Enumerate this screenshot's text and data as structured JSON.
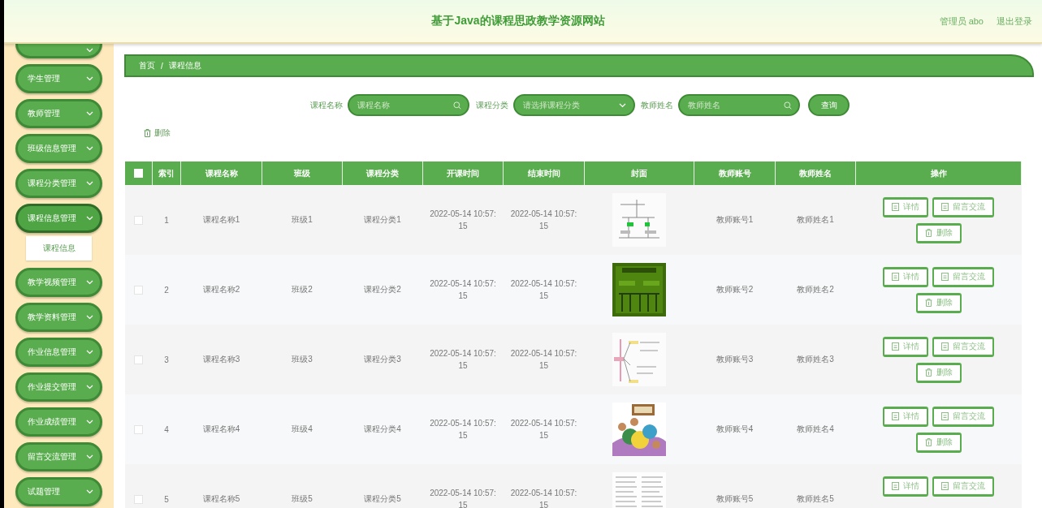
{
  "header": {
    "title": "基于Java的课程思政教学资源网站",
    "user": "管理员 abo",
    "logout": "退出登录"
  },
  "sidebar": {
    "items": [
      {
        "expanded": false
      },
      {
        "label": "学生管理",
        "expanded": false
      },
      {
        "label": "教师管理",
        "expanded": false
      },
      {
        "label": "班级信息管理",
        "expanded": false
      },
      {
        "label": "课程分类管理",
        "expanded": false
      },
      {
        "label": "课程信息管理",
        "expanded": true,
        "children": [
          {
            "label": "课程信息",
            "selected": true
          }
        ]
      },
      {
        "label": "教学视频管理",
        "expanded": false
      },
      {
        "label": "教学资料管理",
        "expanded": false
      },
      {
        "label": "作业信息管理",
        "expanded": false
      },
      {
        "label": "作业提交管理",
        "expanded": false
      },
      {
        "label": "作业成绩管理",
        "expanded": false
      },
      {
        "label": "留言交流管理",
        "expanded": false
      },
      {
        "label": "试题管理",
        "expanded": false
      }
    ]
  },
  "breadcrumb": {
    "items": [
      "首页",
      "课程信息"
    ],
    "separator": "/"
  },
  "search": {
    "fields": [
      {
        "label": "课程名称",
        "placeholder": "课程名称",
        "kind": "text"
      },
      {
        "label": "课程分类",
        "placeholder": "请选择课程分类",
        "kind": "select"
      },
      {
        "label": "教师姓名",
        "placeholder": "教师姓名",
        "kind": "text"
      }
    ],
    "button": "查询"
  },
  "toolbar": {
    "delete": "删除"
  },
  "table": {
    "select_all": {
      "checked": false
    },
    "columns": [
      "索引",
      "课程名称",
      "班级",
      "课程分类",
      "开课时间",
      "结束时间",
      "封面",
      "教师账号",
      "教师姓名",
      "操作"
    ],
    "rows": [
      {
        "checked": false,
        "index": "1",
        "name": "课程名称1",
        "class": "班级1",
        "category": "课程分类1",
        "start": "2022-05-14 10:57:15",
        "end": "2022-05-14 10:57:15",
        "cover": {
          "kind": "picture"
        },
        "teacher_account": "教师账号1",
        "teacher_name": "教师姓名1",
        "actions": [
          {
            "label": "详情",
            "kind": "doc"
          },
          {
            "label": "留言交流",
            "kind": "doc"
          },
          {
            "label": "删除",
            "kind": "delete"
          }
        ]
      },
      {
        "checked": false,
        "index": "2",
        "name": "课程名称2",
        "class": "班级2",
        "category": "课程分类2",
        "start": "2022-05-14 10:57:15",
        "end": "2022-05-14 10:57:15",
        "cover": {
          "kind": "picture"
        },
        "teacher_account": "教师账号2",
        "teacher_name": "教师姓名2",
        "actions": [
          {
            "label": "详情",
            "kind": "doc"
          },
          {
            "label": "留言交流",
            "kind": "doc"
          },
          {
            "label": "删除",
            "kind": "delete"
          }
        ]
      },
      {
        "checked": false,
        "index": "3",
        "name": "课程名称3",
        "class": "班级3",
        "category": "课程分类3",
        "start": "2022-05-14 10:57:15",
        "end": "2022-05-14 10:57:15",
        "cover": {
          "kind": "picture"
        },
        "teacher_account": "教师账号3",
        "teacher_name": "教师姓名3",
        "actions": [
          {
            "label": "详情",
            "kind": "doc"
          },
          {
            "label": "留言交流",
            "kind": "doc"
          },
          {
            "label": "删除",
            "kind": "delete"
          }
        ]
      },
      {
        "checked": false,
        "index": "4",
        "name": "课程名称4",
        "class": "班级4",
        "category": "课程分类4",
        "start": "2022-05-14 10:57:15",
        "end": "2022-05-14 10:57:15",
        "cover": {
          "kind": "picture"
        },
        "teacher_account": "教师账号4",
        "teacher_name": "教师姓名4",
        "actions": [
          {
            "label": "详情",
            "kind": "doc"
          },
          {
            "label": "留言交流",
            "kind": "doc"
          },
          {
            "label": "删除",
            "kind": "delete"
          }
        ]
      },
      {
        "checked": false,
        "index": "5",
        "name": "课程名称5",
        "class": "班级5",
        "category": "课程分类5",
        "start": "2022-05-14 10:57:15",
        "end": "2022-05-14 10:57:15",
        "cover": {
          "kind": "picture"
        },
        "teacher_account": "教师账号5",
        "teacher_name": "教师姓名5",
        "actions": [
          {
            "label": "详情",
            "kind": "doc"
          },
          {
            "label": "留言交流",
            "kind": "doc"
          }
        ]
      }
    ]
  }
}
